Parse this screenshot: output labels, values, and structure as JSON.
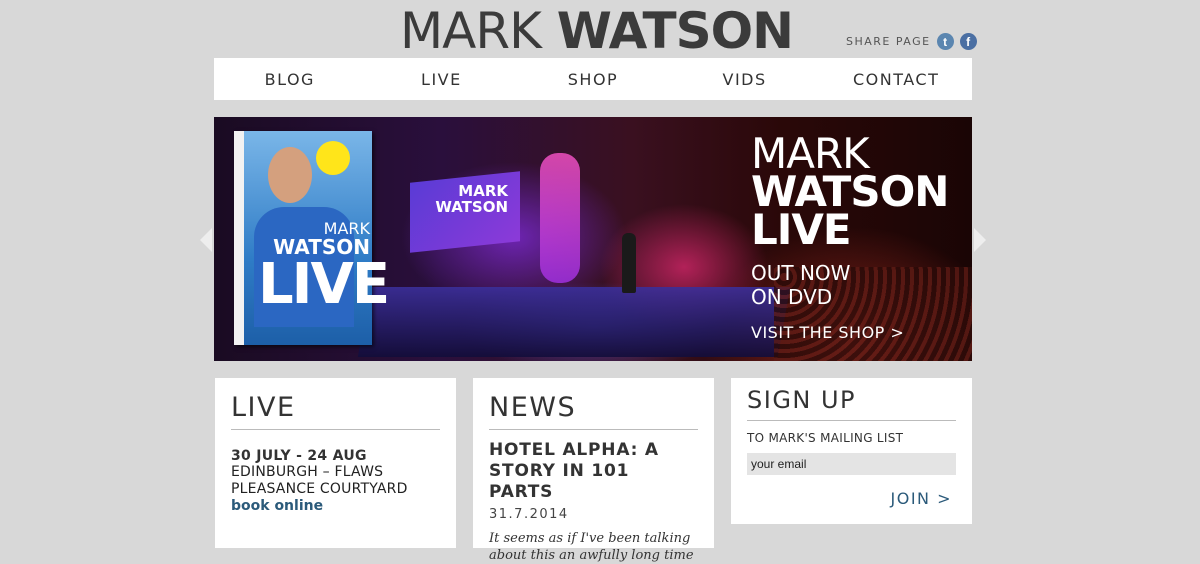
{
  "header": {
    "logo_first": "MARK",
    "logo_last": "WATSON",
    "share_label": "SHARE PAGE",
    "share_icons": [
      {
        "name": "twitter-icon",
        "glyph": "t"
      },
      {
        "name": "facebook-icon",
        "glyph": "f"
      }
    ]
  },
  "nav": {
    "items": [
      "BLOG",
      "LIVE",
      "SHOP",
      "VIDS",
      "CONTACT"
    ]
  },
  "hero": {
    "title_line1": "MARK",
    "title_line2": "WATSON",
    "title_line3": "LIVE",
    "sub_line1": "OUT NOW",
    "sub_line2": "ON DVD",
    "link": "VISIT THE SHOP >",
    "stage_screen_text_1": "MARK",
    "stage_screen_text_2": "WATSON",
    "dvd_title_1": "MARK",
    "dvd_title_2": "WATSON",
    "dvd_title_3": "LIVE"
  },
  "live": {
    "title": "LIVE",
    "date": "30 JULY - 24 AUG",
    "line1": "EDINBURGH – FLAWS",
    "line2": "PLEASANCE COURTYARD",
    "book": "book online"
  },
  "news": {
    "title": "NEWS",
    "headline": "HOTEL ALPHA: A STORY IN 101 PARTS",
    "date": "31.7.2014",
    "excerpt": "It seems as if I've been talking about this an awfully long time"
  },
  "signup": {
    "title": "SIGN UP",
    "label": "TO MARK'S MAILING LIST",
    "placeholder": "your email",
    "join": "JOIN >"
  },
  "colors": {
    "background": "#d8d8d8",
    "link_blue": "#2b5a7a",
    "facebook": "#4b6fa3",
    "twitter": "#5b86b0"
  }
}
